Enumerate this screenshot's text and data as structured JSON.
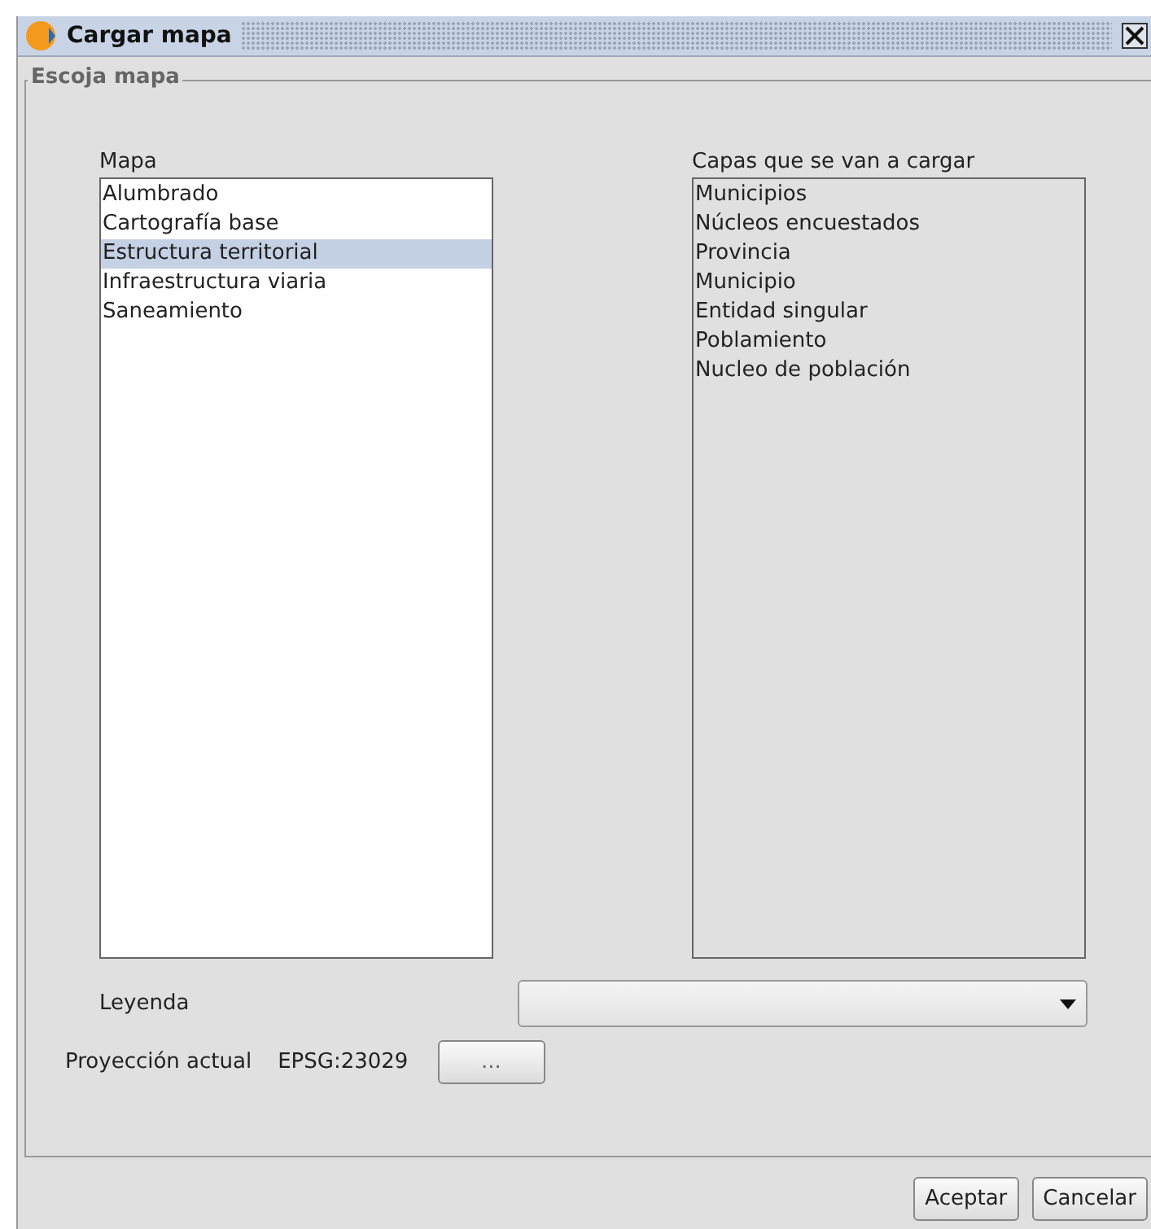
{
  "window": {
    "title": "Cargar mapa"
  },
  "group": {
    "title": "Escoja mapa"
  },
  "maps": {
    "label": "Mapa",
    "items": [
      {
        "label": "Alumbrado",
        "selected": false
      },
      {
        "label": "Cartografía base",
        "selected": false
      },
      {
        "label": "Estructura territorial",
        "selected": true
      },
      {
        "label": "Infraestructura viaria",
        "selected": false
      },
      {
        "label": "Saneamiento",
        "selected": false
      }
    ]
  },
  "layers": {
    "label": "Capas que se van a cargar",
    "items": [
      "Municipios",
      "Núcleos encuestados",
      "Provincia",
      "Municipio",
      "Entidad singular",
      "Poblamiento",
      "Nucleo de población"
    ]
  },
  "legend": {
    "label": "Leyenda"
  },
  "projection": {
    "label": "Proyección actual",
    "value": "EPSG:23029",
    "button": "..."
  },
  "buttons": [
    "Aceptar",
    "Cancelar"
  ]
}
